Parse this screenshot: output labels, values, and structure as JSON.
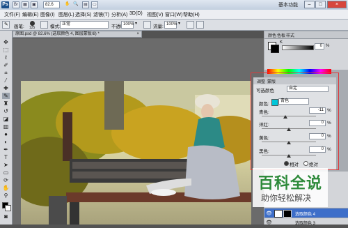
{
  "titlebar": {
    "logo": "Ps",
    "zoom": "82.6",
    "workspace": "基本功能",
    "minimize": "–",
    "maximize": "□",
    "close": "×"
  },
  "menu": [
    "文件(F)",
    "编辑(E)",
    "图像(I)",
    "图层(L)",
    "选择(S)",
    "滤镜(T)",
    "分析(A)",
    "3D(D)",
    "视图(V)",
    "窗口(W)",
    "帮助(H)"
  ],
  "options": {
    "brush_label": "画笔:",
    "brush_size": "125",
    "mode_label": "模式:",
    "mode_value": "正常",
    "opacity_label": "不透明度:",
    "opacity_value": "100%",
    "flow_label": "流量:",
    "flow_value": "100%"
  },
  "document": {
    "tab_title": "原图.psd @ 82.6% (选取颜色 4, 图层蒙版/8) *",
    "close": "×"
  },
  "color_panel": {
    "tabs": [
      "颜色",
      "色板",
      "样式"
    ],
    "k_value": "0",
    "percent": "%"
  },
  "adjustments": {
    "tabs": [
      "调整",
      "蒙版"
    ],
    "title": "可选颜色",
    "preset": "自定",
    "colors_label": "颜色:",
    "colors_value": "青色",
    "cyan_label": "青色:",
    "cyan_value": "-11",
    "magenta_label": "洋红:",
    "magenta_value": "0",
    "yellow_label": "黄色:",
    "yellow_value": "0",
    "black_label": "黑色:",
    "black_value": "0",
    "percent": "%",
    "relative_label": "相对",
    "absolute_label": "绝对",
    "slider_positions": {
      "cyan": 0.44,
      "magenta": 0.5,
      "yellow": 0.5,
      "black": 0.5
    }
  },
  "layers": {
    "row1_name": "选取颜色 4",
    "row2_name": "选取颜色 3"
  },
  "watermark": {
    "title": "百科全说",
    "subtitle": "助你轻松解决"
  },
  "colors": {
    "accent_frame": "#e0383a",
    "watermark_green": "#2d8a3a"
  }
}
